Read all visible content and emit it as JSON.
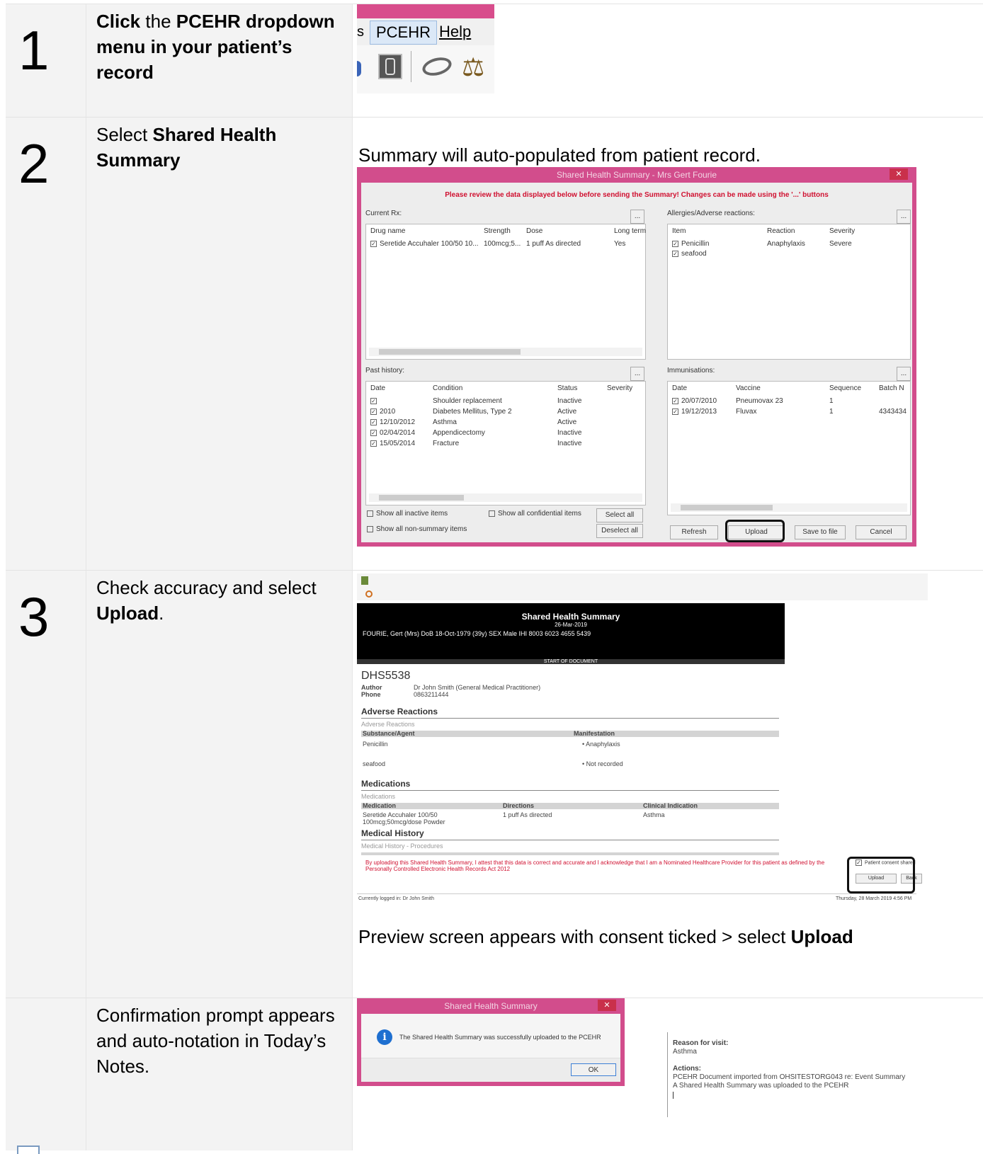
{
  "steps": [
    {
      "number": "1",
      "text_bold_1": "Click",
      "text_1": " the ",
      "text_bold_2": "PCEHR dropdown menu in your patient’s record"
    },
    {
      "number": "2",
      "text_1": "Select ",
      "text_bold_1": "Shared Health Summary",
      "caption": "Summary will auto-populated from patient record."
    },
    {
      "number": "3",
      "text_1": "Check accuracy and select ",
      "text_bold_1": "Upload",
      "text_2": ".",
      "caption_1": "Preview screen appears with consent ticked > select ",
      "caption_bold": "Upload"
    },
    {
      "number": "",
      "text_1": "Confirmation prompt appears and auto-notation in Today’s Notes."
    }
  ],
  "menu": {
    "left_char": "s",
    "pcehr": "PCEHR",
    "help": "Help"
  },
  "shs_window": {
    "title": "Shared Health Summary - Mrs Gert Fourie",
    "warning": "Please review the data displayed below before sending the Summary!  Changes can be made using the '...' buttons",
    "current_rx": {
      "label": "Current Rx:",
      "headers": [
        "Drug name",
        "Strength",
        "Dose",
        "Long term"
      ],
      "rows": [
        [
          "Seretide Accuhaler 100/50 10...",
          "100mcg;5...",
          "1 puff As directed",
          "Yes"
        ]
      ]
    },
    "allergies": {
      "label": "Allergies/Adverse reactions:",
      "headers": [
        "Item",
        "Reaction",
        "Severity"
      ],
      "rows": [
        [
          "Penicillin",
          "Anaphylaxis",
          "Severe"
        ],
        [
          "seafood",
          "",
          ""
        ]
      ]
    },
    "past_history": {
      "label": "Past history:",
      "headers": [
        "Date",
        "Condition",
        "Status",
        "Severity"
      ],
      "rows": [
        [
          "",
          "Shoulder replacement",
          "Inactive",
          ""
        ],
        [
          "2010",
          "Diabetes Mellitus, Type 2",
          "Active",
          ""
        ],
        [
          "12/10/2012",
          "Asthma",
          "Active",
          ""
        ],
        [
          "02/04/2014",
          "Appendicectomy",
          "Inactive",
          ""
        ],
        [
          "15/05/2014",
          "Fracture",
          "Inactive",
          ""
        ]
      ]
    },
    "immunisations": {
      "label": "Immunisations:",
      "headers": [
        "Date",
        "Vaccine",
        "Sequence",
        "Batch N"
      ],
      "rows": [
        [
          "20/07/2010",
          "Pneumovax 23",
          "1",
          ""
        ],
        [
          "19/12/2013",
          "Fluvax",
          "1",
          "4343434"
        ]
      ]
    },
    "options": [
      "Show all inactive items",
      "Show all non-summary items",
      "Show all confidential items"
    ],
    "buttons": {
      "select_all": "Select all",
      "deselect_all": "Deselect all",
      "refresh": "Refresh",
      "upload": "Upload",
      "save": "Save to file",
      "cancel": "Cancel"
    }
  },
  "preview": {
    "banner_title": "Shared Health Summary",
    "banner_date": "26-Mar-2019",
    "patient_line": "FOURIE, Gert (Mrs)     DoB 18-Oct-1979 (39y)     SEX Male     IHI 8003 6023 4655 5439",
    "start_doc": "START OF DOCUMENT",
    "doc_id": "DHS5538",
    "author_label": "Author",
    "author_value": "Dr John Smith (General Medical Practitioner)",
    "phone_label": "Phone",
    "phone_value": "0863211444",
    "adverse_heading": "Adverse Reactions",
    "adverse_sub": "Adverse Reactions",
    "adverse_cols": [
      "Substance/Agent",
      "Manifestation"
    ],
    "adverse_rows": [
      [
        "Penicillin",
        "• Anaphylaxis"
      ],
      [
        "seafood",
        "• Not recorded"
      ]
    ],
    "med_heading": "Medications",
    "med_sub": "Medications",
    "med_cols": [
      "Medication",
      "Directions",
      "Clinical Indication"
    ],
    "med_row": [
      "Seretide Accuhaler 100/50 100mcg;50mcg/dose Powder",
      "1 puff As directed",
      "Asthma"
    ],
    "history_heading": "Medical History",
    "history_sub": "Medical History - Procedures",
    "consent_text": "By uploading this Shared Health Summary, I attest that this data is correct and accurate and I acknowledge that I am a Nominated Healthcare Provider for this patient as defined by the Personally Controlled Electronic Health Records Act 2012",
    "consent_check": "Patient consent shared",
    "upload_btn": "Upload",
    "back_btn": "Back",
    "footer_left": "Currently logged in: Dr John Smith",
    "footer_right": "Thursday, 28 March 2019 4:56 PM"
  },
  "confirm": {
    "title": "Shared Health Summary",
    "message": "The Shared Health Summary was successfully uploaded to the PCEHR",
    "ok": "OK"
  },
  "notes": {
    "reason_label": "Reason for visit:",
    "reason_value": "Asthma",
    "actions_label": "Actions:",
    "action_1": "PCEHR Document imported from OHSITESTORG043 re: Event Summary",
    "action_2": "A Shared Health Summary was uploaded to the PCEHR"
  }
}
